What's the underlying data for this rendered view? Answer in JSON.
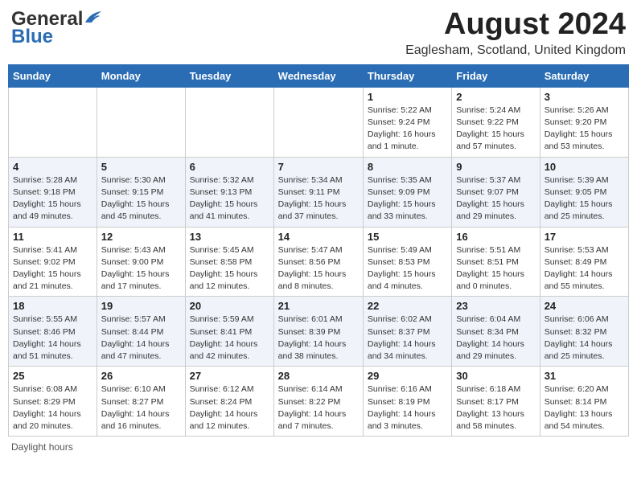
{
  "header": {
    "logo_general": "General",
    "logo_blue": "Blue",
    "month_year": "August 2024",
    "location": "Eaglesham, Scotland, United Kingdom"
  },
  "weekdays": [
    "Sunday",
    "Monday",
    "Tuesday",
    "Wednesday",
    "Thursday",
    "Friday",
    "Saturday"
  ],
  "footer": {
    "daylight_label": "Daylight hours"
  },
  "weeks": [
    [
      {
        "day": "",
        "info": ""
      },
      {
        "day": "",
        "info": ""
      },
      {
        "day": "",
        "info": ""
      },
      {
        "day": "",
        "info": ""
      },
      {
        "day": "1",
        "info": "Sunrise: 5:22 AM\nSunset: 9:24 PM\nDaylight: 16 hours and 1 minute."
      },
      {
        "day": "2",
        "info": "Sunrise: 5:24 AM\nSunset: 9:22 PM\nDaylight: 15 hours and 57 minutes."
      },
      {
        "day": "3",
        "info": "Sunrise: 5:26 AM\nSunset: 9:20 PM\nDaylight: 15 hours and 53 minutes."
      }
    ],
    [
      {
        "day": "4",
        "info": "Sunrise: 5:28 AM\nSunset: 9:18 PM\nDaylight: 15 hours and 49 minutes."
      },
      {
        "day": "5",
        "info": "Sunrise: 5:30 AM\nSunset: 9:15 PM\nDaylight: 15 hours and 45 minutes."
      },
      {
        "day": "6",
        "info": "Sunrise: 5:32 AM\nSunset: 9:13 PM\nDaylight: 15 hours and 41 minutes."
      },
      {
        "day": "7",
        "info": "Sunrise: 5:34 AM\nSunset: 9:11 PM\nDaylight: 15 hours and 37 minutes."
      },
      {
        "day": "8",
        "info": "Sunrise: 5:35 AM\nSunset: 9:09 PM\nDaylight: 15 hours and 33 minutes."
      },
      {
        "day": "9",
        "info": "Sunrise: 5:37 AM\nSunset: 9:07 PM\nDaylight: 15 hours and 29 minutes."
      },
      {
        "day": "10",
        "info": "Sunrise: 5:39 AM\nSunset: 9:05 PM\nDaylight: 15 hours and 25 minutes."
      }
    ],
    [
      {
        "day": "11",
        "info": "Sunrise: 5:41 AM\nSunset: 9:02 PM\nDaylight: 15 hours and 21 minutes."
      },
      {
        "day": "12",
        "info": "Sunrise: 5:43 AM\nSunset: 9:00 PM\nDaylight: 15 hours and 17 minutes."
      },
      {
        "day": "13",
        "info": "Sunrise: 5:45 AM\nSunset: 8:58 PM\nDaylight: 15 hours and 12 minutes."
      },
      {
        "day": "14",
        "info": "Sunrise: 5:47 AM\nSunset: 8:56 PM\nDaylight: 15 hours and 8 minutes."
      },
      {
        "day": "15",
        "info": "Sunrise: 5:49 AM\nSunset: 8:53 PM\nDaylight: 15 hours and 4 minutes."
      },
      {
        "day": "16",
        "info": "Sunrise: 5:51 AM\nSunset: 8:51 PM\nDaylight: 15 hours and 0 minutes."
      },
      {
        "day": "17",
        "info": "Sunrise: 5:53 AM\nSunset: 8:49 PM\nDaylight: 14 hours and 55 minutes."
      }
    ],
    [
      {
        "day": "18",
        "info": "Sunrise: 5:55 AM\nSunset: 8:46 PM\nDaylight: 14 hours and 51 minutes."
      },
      {
        "day": "19",
        "info": "Sunrise: 5:57 AM\nSunset: 8:44 PM\nDaylight: 14 hours and 47 minutes."
      },
      {
        "day": "20",
        "info": "Sunrise: 5:59 AM\nSunset: 8:41 PM\nDaylight: 14 hours and 42 minutes."
      },
      {
        "day": "21",
        "info": "Sunrise: 6:01 AM\nSunset: 8:39 PM\nDaylight: 14 hours and 38 minutes."
      },
      {
        "day": "22",
        "info": "Sunrise: 6:02 AM\nSunset: 8:37 PM\nDaylight: 14 hours and 34 minutes."
      },
      {
        "day": "23",
        "info": "Sunrise: 6:04 AM\nSunset: 8:34 PM\nDaylight: 14 hours and 29 minutes."
      },
      {
        "day": "24",
        "info": "Sunrise: 6:06 AM\nSunset: 8:32 PM\nDaylight: 14 hours and 25 minutes."
      }
    ],
    [
      {
        "day": "25",
        "info": "Sunrise: 6:08 AM\nSunset: 8:29 PM\nDaylight: 14 hours and 20 minutes."
      },
      {
        "day": "26",
        "info": "Sunrise: 6:10 AM\nSunset: 8:27 PM\nDaylight: 14 hours and 16 minutes."
      },
      {
        "day": "27",
        "info": "Sunrise: 6:12 AM\nSunset: 8:24 PM\nDaylight: 14 hours and 12 minutes."
      },
      {
        "day": "28",
        "info": "Sunrise: 6:14 AM\nSunset: 8:22 PM\nDaylight: 14 hours and 7 minutes."
      },
      {
        "day": "29",
        "info": "Sunrise: 6:16 AM\nSunset: 8:19 PM\nDaylight: 14 hours and 3 minutes."
      },
      {
        "day": "30",
        "info": "Sunrise: 6:18 AM\nSunset: 8:17 PM\nDaylight: 13 hours and 58 minutes."
      },
      {
        "day": "31",
        "info": "Sunrise: 6:20 AM\nSunset: 8:14 PM\nDaylight: 13 hours and 54 minutes."
      }
    ]
  ]
}
